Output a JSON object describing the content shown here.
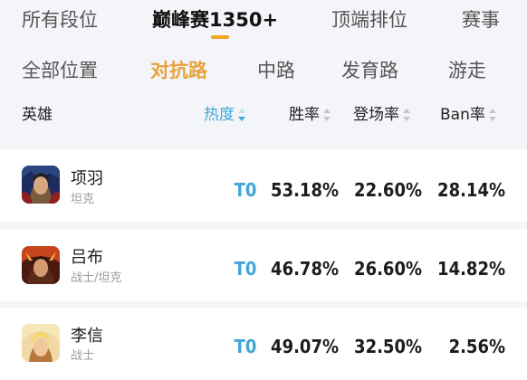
{
  "segment_tabs": [
    {
      "label": "所有段位"
    },
    {
      "label": "巅峰赛1350+"
    },
    {
      "label": "顶端排位"
    },
    {
      "label": "赛事"
    }
  ],
  "position_tabs": [
    {
      "label": "全部位置"
    },
    {
      "label": "对抗路"
    },
    {
      "label": "中路"
    },
    {
      "label": "发育路"
    },
    {
      "label": "游走"
    }
  ],
  "table": {
    "headers": {
      "hero": "英雄",
      "heat": "热度",
      "win_rate": "胜率",
      "pick_rate": "登场率",
      "ban_rate": "Ban率"
    },
    "rows": [
      {
        "name": "项羽",
        "role": "坦克",
        "tier": "T0",
        "win_rate": "53.18%",
        "pick_rate": "22.60%",
        "ban_rate": "28.14%"
      },
      {
        "name": "吕布",
        "role": "战士/坦克",
        "tier": "T0",
        "win_rate": "46.78%",
        "pick_rate": "26.60%",
        "ban_rate": "14.82%"
      },
      {
        "name": "李信",
        "role": "战士",
        "tier": "T0",
        "win_rate": "49.07%",
        "pick_rate": "32.50%",
        "ban_rate": "2.56%"
      }
    ]
  },
  "colors": {
    "accent_tab": "#e5a33a",
    "underline": "#f2a520",
    "tier": "#3ea7d8",
    "background": "#f4f5f9"
  }
}
